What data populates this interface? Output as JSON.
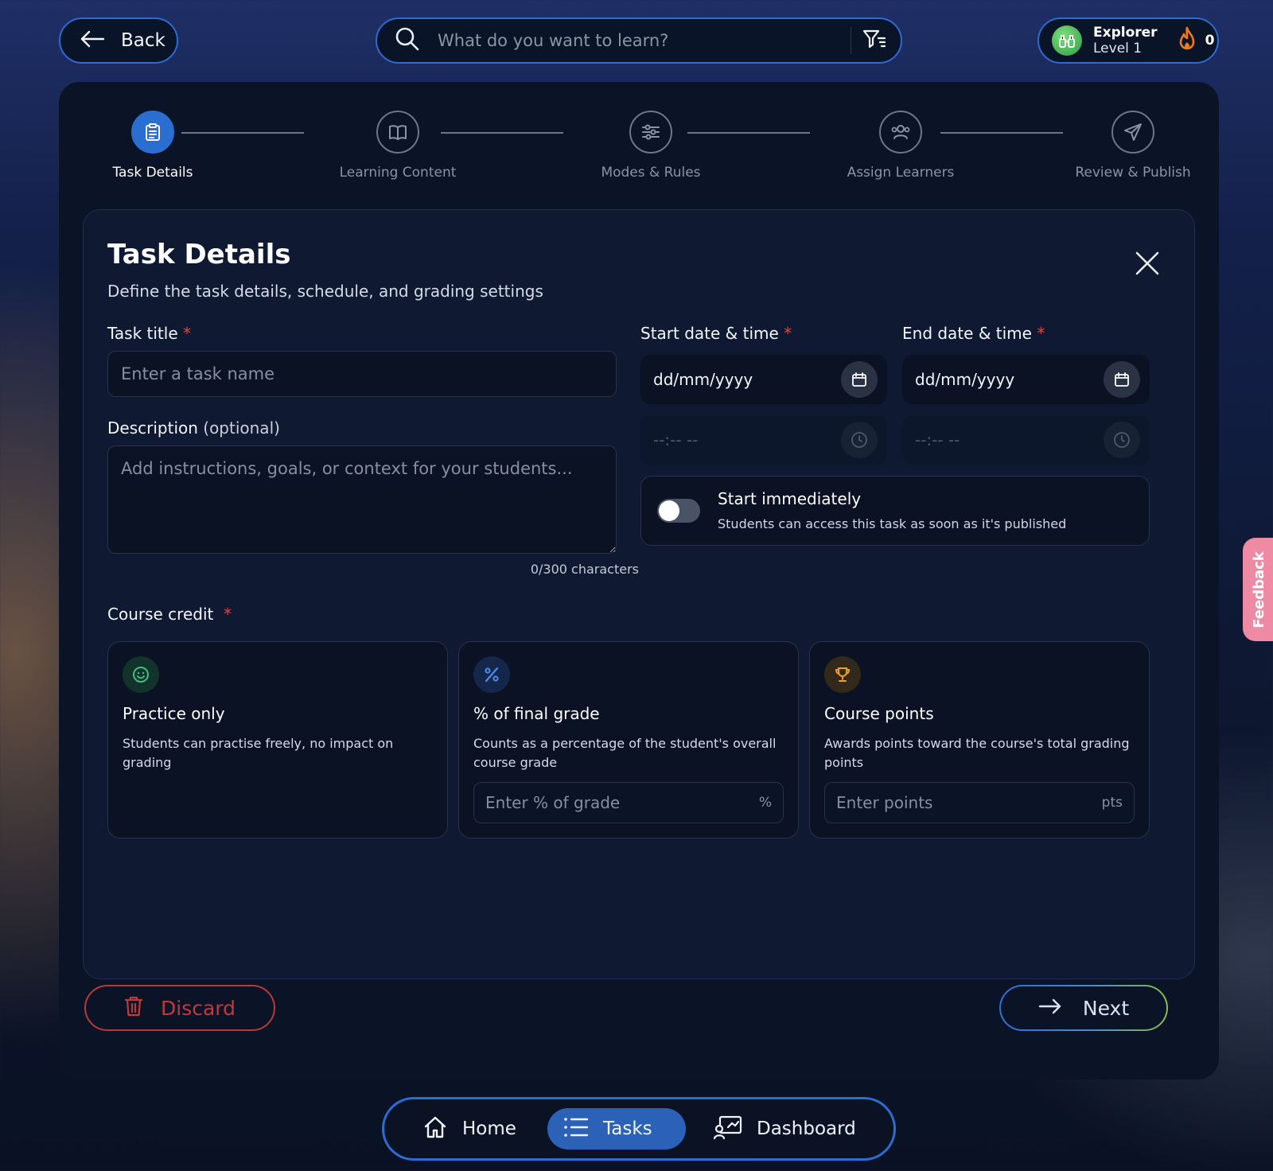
{
  "header": {
    "back_label": "Back",
    "search_placeholder": "What do you want to learn?",
    "profile": {
      "name": "Explorer",
      "level": "Level 1",
      "streak": "0"
    }
  },
  "stepper": {
    "steps": [
      {
        "label": "Task Details",
        "icon": "clipboard-icon",
        "active": true
      },
      {
        "label": "Learning Content",
        "icon": "book-icon",
        "active": false
      },
      {
        "label": "Modes & Rules",
        "icon": "sliders-icon",
        "active": false
      },
      {
        "label": "Assign Learners",
        "icon": "users-icon",
        "active": false
      },
      {
        "label": "Review & Publish",
        "icon": "send-icon",
        "active": false
      }
    ]
  },
  "form": {
    "title": "Task Details",
    "subtitle": "Define the task details, schedule, and grading settings",
    "task_title": {
      "label": "Task title",
      "required_mark": "*",
      "placeholder": "Enter a task name"
    },
    "description": {
      "label": "Description",
      "optional": "(optional)",
      "placeholder": "Add instructions, goals, or context for your students...",
      "char_count": "0/300 characters"
    },
    "start": {
      "label": "Start date & time",
      "required_mark": "*",
      "date": "dd/mm/yyyy",
      "time": "--:-- --"
    },
    "end": {
      "label": "End date & time",
      "required_mark": "*",
      "date": "dd/mm/yyyy",
      "time": "--:-- --"
    },
    "start_immediately": {
      "title": "Start immediately",
      "description": "Students can access this task as soon as it's published",
      "enabled": false
    },
    "course_credit": {
      "label": "Course credit",
      "required_mark": "*",
      "options": [
        {
          "title": "Practice only",
          "description": "Students can practise freely, no impact on grading",
          "icon": "smiley-icon",
          "color": "#3fbf7f"
        },
        {
          "title": "% of final grade",
          "description": "Counts as a percentage of the student's overall course grade",
          "icon": "percent-icon",
          "color": "#4d8df0",
          "placeholder": "Enter % of grade",
          "unit": "%"
        },
        {
          "title": "Course points",
          "description": "Awards points toward the course's total grading points",
          "icon": "trophy-icon",
          "color": "#f0a020",
          "placeholder": "Enter points",
          "unit": "pts"
        }
      ]
    }
  },
  "actions": {
    "discard": "Discard",
    "next": "Next"
  },
  "bottom_nav": {
    "items": [
      {
        "label": "Home",
        "icon": "home-icon",
        "active": false
      },
      {
        "label": "Tasks",
        "icon": "list-icon",
        "active": true
      },
      {
        "label": "Dashboard",
        "icon": "dashboard-icon",
        "active": false
      }
    ]
  },
  "feedback_label": "Feedback",
  "colors": {
    "accent": "#2b6ed1",
    "danger": "#c0393a",
    "required": "#e0453c"
  }
}
